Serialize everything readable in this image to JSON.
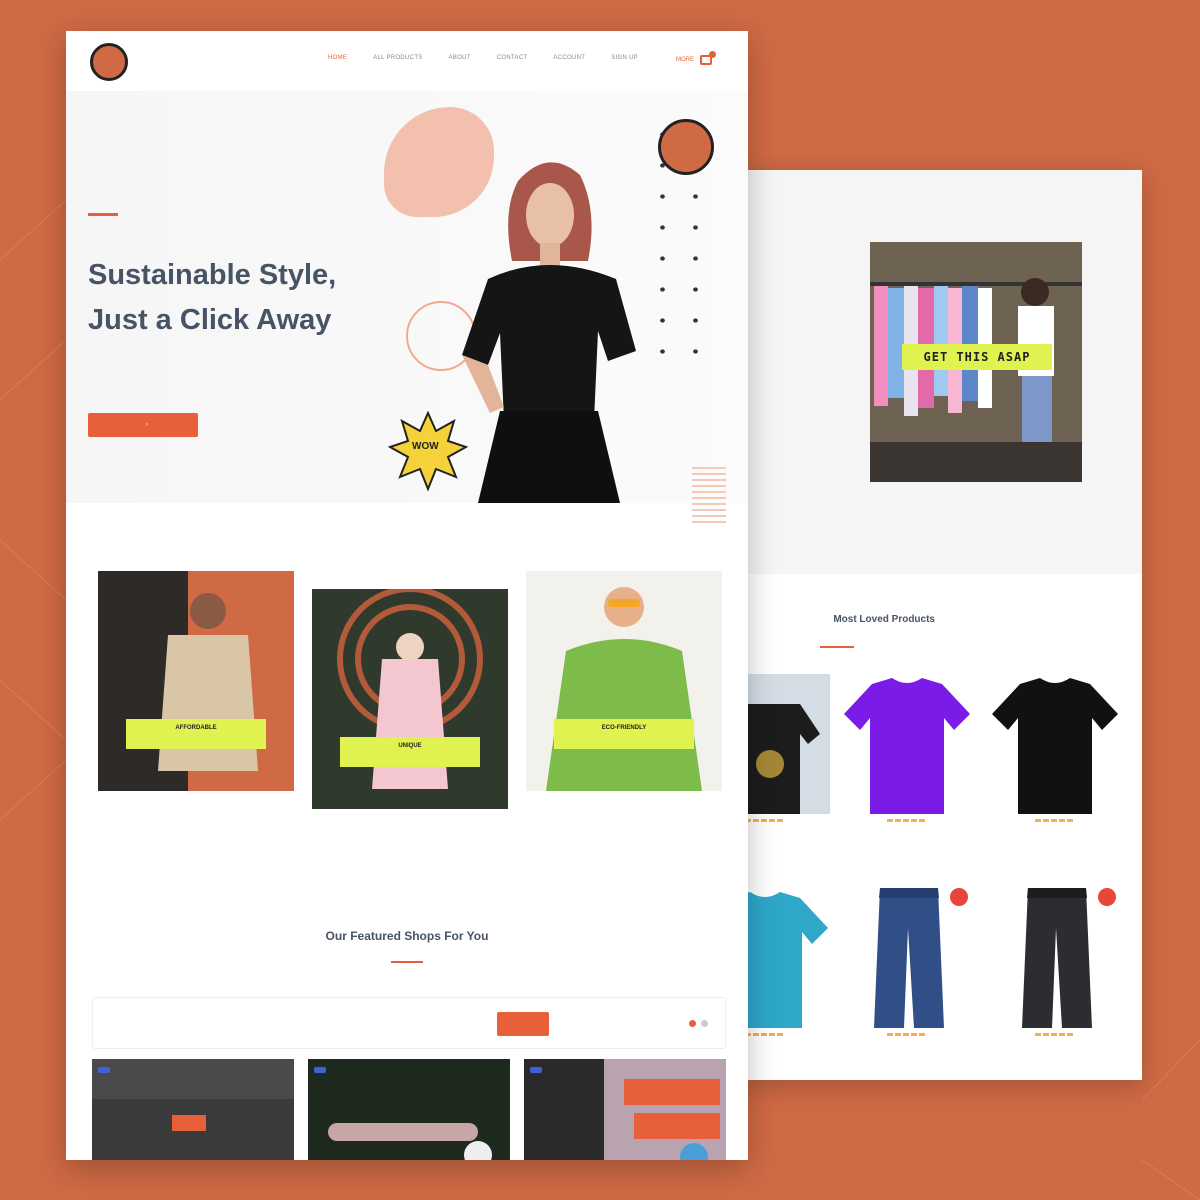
{
  "colors": {
    "background": "#cf6a45",
    "accent": "#e8603a",
    "highlight": "#dff24f",
    "heading": "#475466"
  },
  "nav": {
    "links": [
      "HOME",
      "ALL PRODUCTS",
      "ABOUT",
      "CONTACT",
      "ACCOUNT",
      "SIGN UP"
    ],
    "cart_label": "MORE",
    "icons": [
      "logo",
      "cart-icon"
    ]
  },
  "hero": {
    "eyebrow": "",
    "title_line1": "Sustainable Style,",
    "title_line2": "Just a Click Away",
    "description": "",
    "cta_label": "",
    "sticker_label": "WOW"
  },
  "collections": [
    {
      "caption": "AFFORDABLE",
      "caption_sub": "",
      "label": "",
      "subtitle": ""
    },
    {
      "top_label": "",
      "top_subtitle": "",
      "caption": "UNIQUE",
      "caption_sub": ""
    },
    {
      "caption": "ECO-FRIENDLY",
      "caption_sub": "",
      "label": "",
      "subtitle": ""
    }
  ],
  "featured": {
    "title": "Our Featured Shops For You",
    "filter_count": "",
    "filter_active": "",
    "filter_opts": [
      "",
      ""
    ],
    "shops": [
      {
        "tag": ""
      },
      {
        "tag": ""
      },
      {
        "tag": ""
      }
    ]
  },
  "back_page": {
    "banner_tag": "GET THIS ASAP",
    "loved_title": "Most Loved Products",
    "products": [
      {
        "category": "",
        "name": "",
        "price": ""
      },
      {
        "category": "",
        "name": "",
        "price": ""
      },
      {
        "category": "",
        "name": "",
        "price": ""
      },
      {
        "category": "",
        "name": "",
        "price": ""
      },
      {
        "category": "",
        "name": "",
        "price": ""
      },
      {
        "category": "",
        "name": "",
        "price": ""
      }
    ]
  }
}
